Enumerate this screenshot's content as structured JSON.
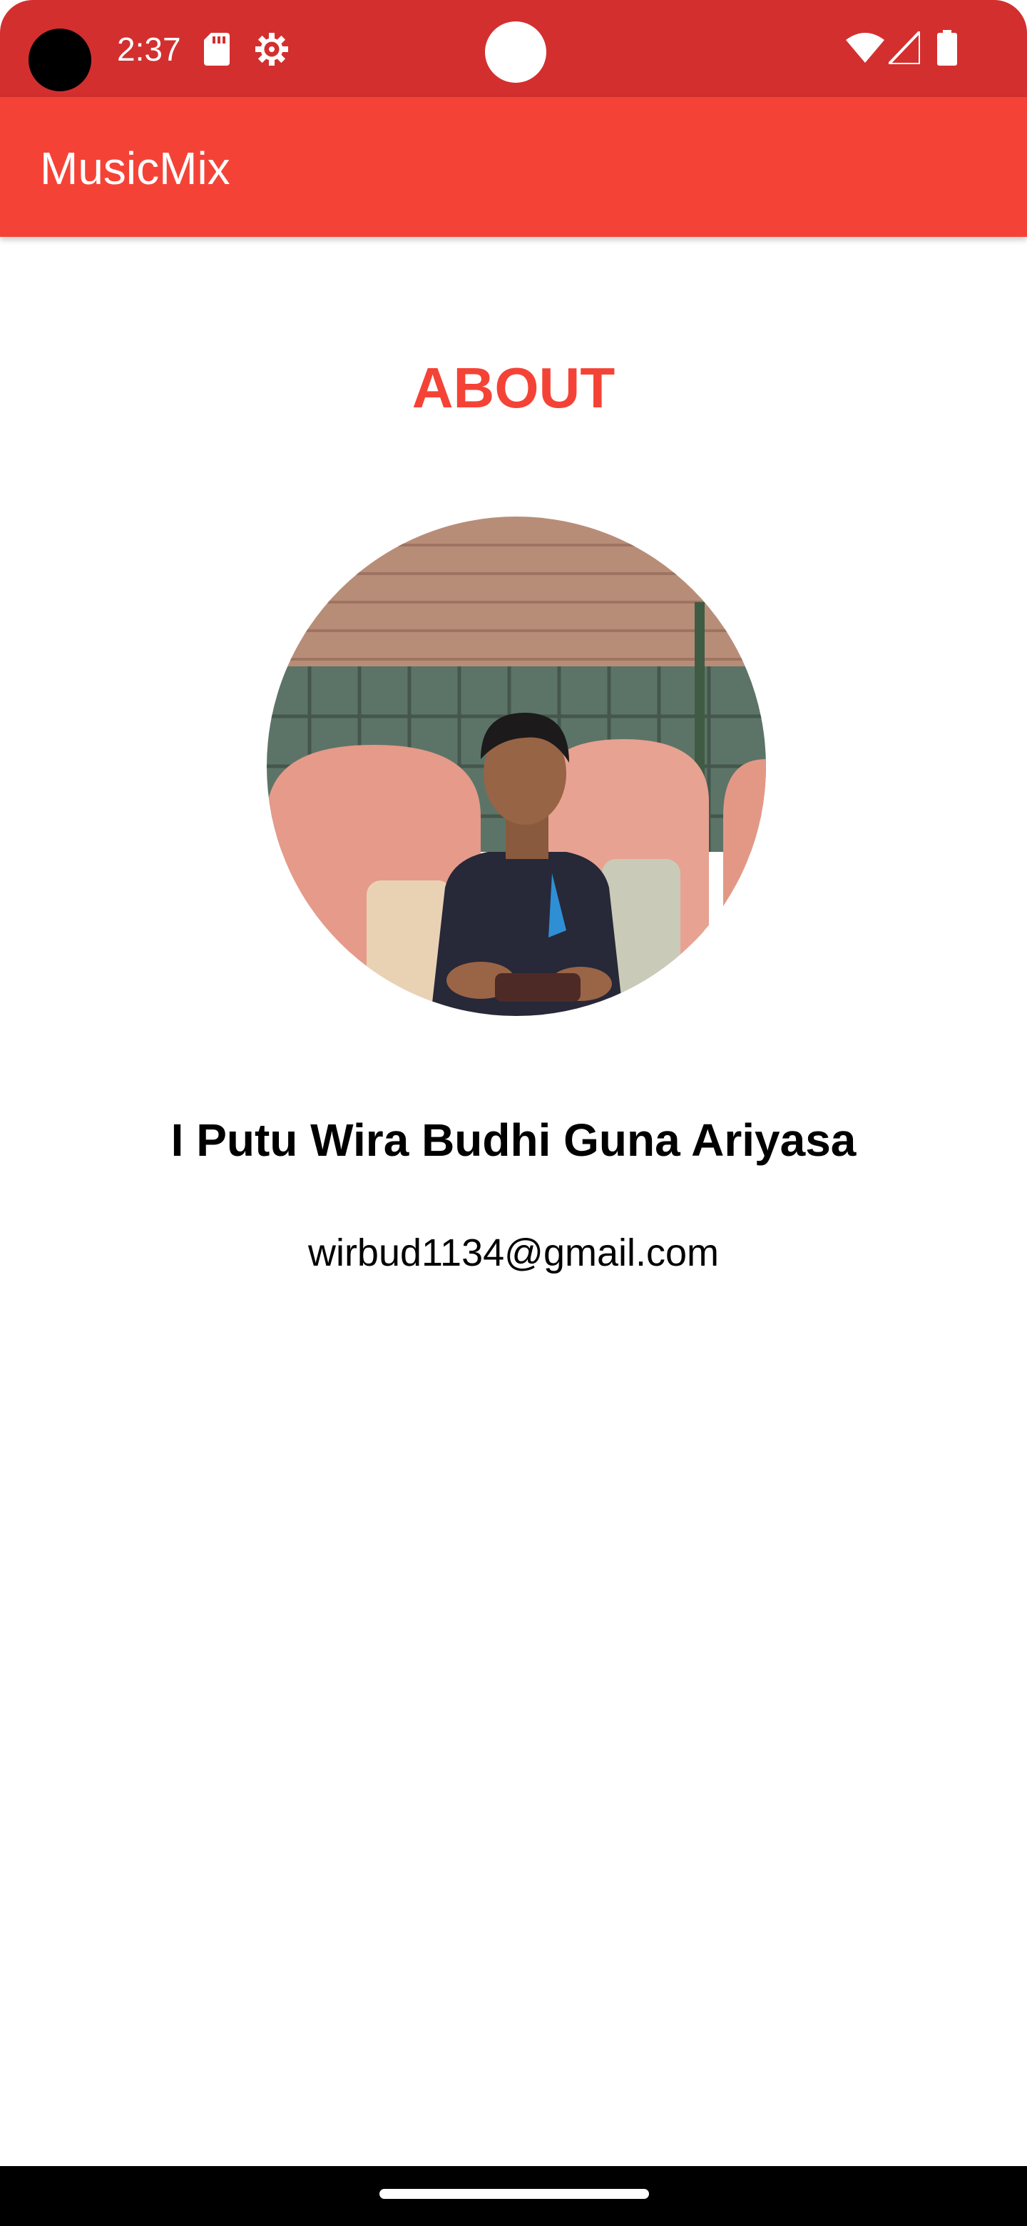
{
  "status_bar": {
    "time": "2:37",
    "icons": [
      "camera-cutout",
      "sd-card-icon",
      "settings-gear-icon",
      "wifi-icon",
      "cell-signal-icon",
      "battery-icon"
    ],
    "color": "#d32f2f"
  },
  "app_bar": {
    "title": "MusicMix",
    "color": "#f44336"
  },
  "about": {
    "heading": "ABOUT",
    "accent_color": "#f44336",
    "profile": {
      "avatar": "profile-photo",
      "name": "I Putu Wira Budhi Guna Ariyasa",
      "email": "wirbud1134@gmail.com"
    }
  },
  "nav_bar": {
    "handle": "home-indicator"
  }
}
